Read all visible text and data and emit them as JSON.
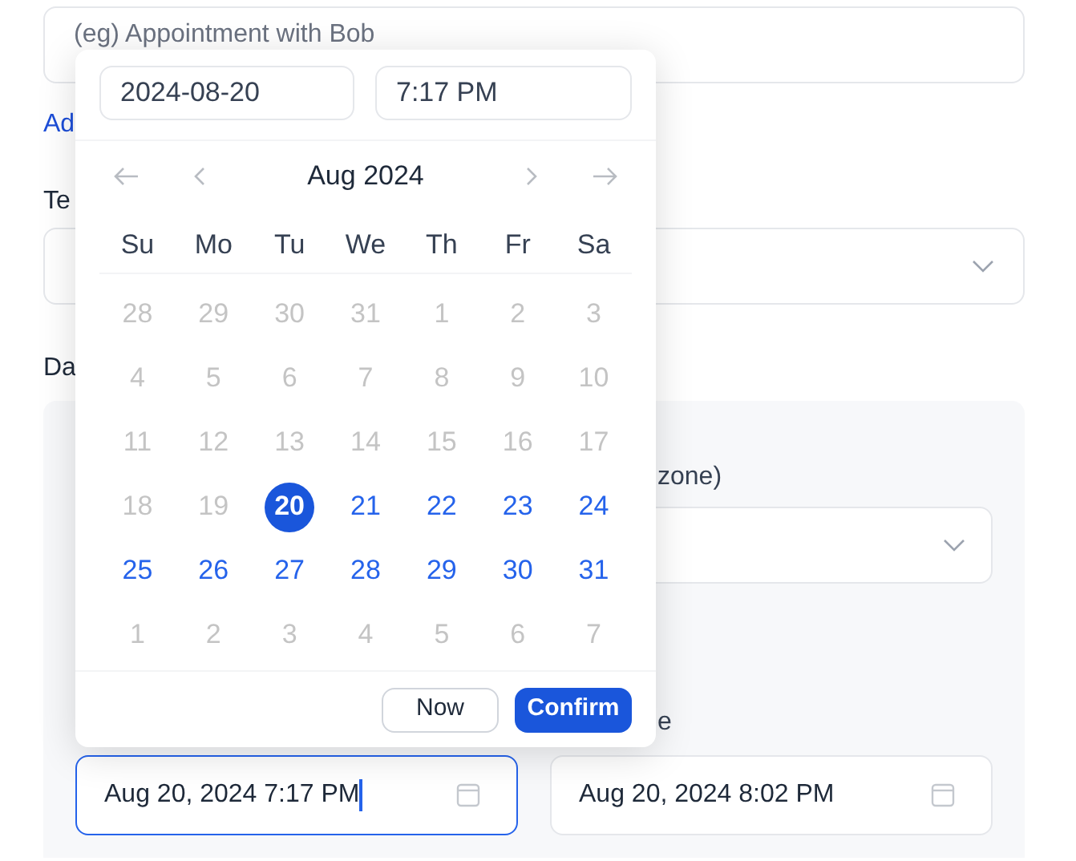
{
  "form": {
    "title_field": {
      "placeholder": "(eg) Appointment with Bob"
    },
    "add_link": "Ad",
    "team_label": "Te",
    "date_label": "Da",
    "timezone_label": "zone)",
    "end_label": "e",
    "start_field": {
      "value": "Aug 20, 2024 7:17 PM",
      "focused": true
    },
    "end_field": {
      "value": "Aug 20, 2024 8:02 PM",
      "focused": false
    }
  },
  "picker": {
    "date_input": "2024-08-20",
    "time_input": "7:17 PM",
    "month": "Aug 2024",
    "weekdays": [
      "Su",
      "Mo",
      "Tu",
      "We",
      "Th",
      "Fr",
      "Sa"
    ],
    "weeks": [
      [
        {
          "day": "28",
          "disabled": true,
          "selected": false
        },
        {
          "day": "29",
          "disabled": true,
          "selected": false
        },
        {
          "day": "30",
          "disabled": true,
          "selected": false
        },
        {
          "day": "31",
          "disabled": true,
          "selected": false
        },
        {
          "day": "1",
          "disabled": true,
          "selected": false
        },
        {
          "day": "2",
          "disabled": true,
          "selected": false
        },
        {
          "day": "3",
          "disabled": true,
          "selected": false
        }
      ],
      [
        {
          "day": "4",
          "disabled": true,
          "selected": false
        },
        {
          "day": "5",
          "disabled": true,
          "selected": false
        },
        {
          "day": "6",
          "disabled": true,
          "selected": false
        },
        {
          "day": "7",
          "disabled": true,
          "selected": false
        },
        {
          "day": "8",
          "disabled": true,
          "selected": false
        },
        {
          "day": "9",
          "disabled": true,
          "selected": false
        },
        {
          "day": "10",
          "disabled": true,
          "selected": false
        }
      ],
      [
        {
          "day": "11",
          "disabled": true,
          "selected": false
        },
        {
          "day": "12",
          "disabled": true,
          "selected": false
        },
        {
          "day": "13",
          "disabled": true,
          "selected": false
        },
        {
          "day": "14",
          "disabled": true,
          "selected": false
        },
        {
          "day": "15",
          "disabled": true,
          "selected": false
        },
        {
          "day": "16",
          "disabled": true,
          "selected": false
        },
        {
          "day": "17",
          "disabled": true,
          "selected": false
        }
      ],
      [
        {
          "day": "18",
          "disabled": true,
          "selected": false
        },
        {
          "day": "19",
          "disabled": true,
          "selected": false
        },
        {
          "day": "20",
          "disabled": false,
          "selected": true
        },
        {
          "day": "21",
          "disabled": false,
          "selected": false
        },
        {
          "day": "22",
          "disabled": false,
          "selected": false
        },
        {
          "day": "23",
          "disabled": false,
          "selected": false
        },
        {
          "day": "24",
          "disabled": false,
          "selected": false
        }
      ],
      [
        {
          "day": "25",
          "disabled": false,
          "selected": false
        },
        {
          "day": "26",
          "disabled": false,
          "selected": false
        },
        {
          "day": "27",
          "disabled": false,
          "selected": false
        },
        {
          "day": "28",
          "disabled": false,
          "selected": false
        },
        {
          "day": "29",
          "disabled": false,
          "selected": false
        },
        {
          "day": "30",
          "disabled": false,
          "selected": false
        },
        {
          "day": "31",
          "disabled": false,
          "selected": false
        }
      ],
      [
        {
          "day": "1",
          "disabled": true,
          "selected": false
        },
        {
          "day": "2",
          "disabled": true,
          "selected": false
        },
        {
          "day": "3",
          "disabled": true,
          "selected": false
        },
        {
          "day": "4",
          "disabled": true,
          "selected": false
        },
        {
          "day": "5",
          "disabled": true,
          "selected": false
        },
        {
          "day": "6",
          "disabled": true,
          "selected": false
        },
        {
          "day": "7",
          "disabled": true,
          "selected": false
        }
      ]
    ],
    "buttons": {
      "now": "Now",
      "confirm": "Confirm"
    }
  }
}
